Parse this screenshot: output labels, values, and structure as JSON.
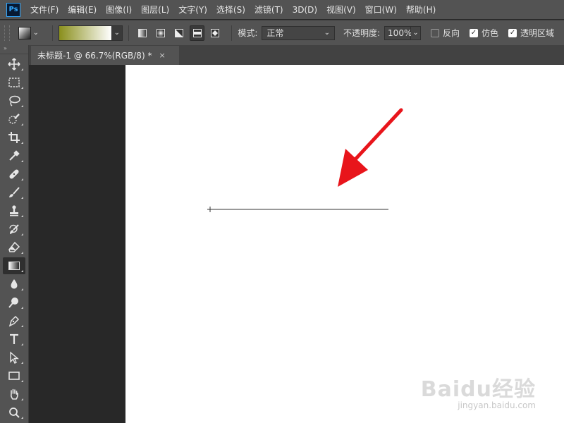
{
  "menubar": {
    "app_logo": "Ps",
    "items": [
      "文件(F)",
      "编辑(E)",
      "图像(I)",
      "图层(L)",
      "文字(Y)",
      "选择(S)",
      "滤镜(T)",
      "3D(D)",
      "视图(V)",
      "窗口(W)",
      "帮助(H)"
    ]
  },
  "options": {
    "gradient_colors": [
      "#8a8f1c",
      "#ffffff"
    ],
    "gradient_types": [
      "linear-gradient-icon",
      "radial-gradient-icon",
      "angle-gradient-icon",
      "reflected-gradient-icon",
      "diamond-gradient-icon"
    ],
    "active_gradient_type": "reflected-gradient-icon",
    "mode_label": "模式:",
    "mode_value": "正常",
    "opacity_label": "不透明度:",
    "opacity_value": "100%",
    "reverse_label": "反向",
    "reverse_checked": false,
    "dither_label": "仿色",
    "dither_checked": true,
    "transparency_label": "透明区域",
    "transparency_checked": true
  },
  "toolbar": {
    "collapse_glyph": "»",
    "tools": [
      "move-tool-icon",
      "marquee-tool-icon",
      "lasso-tool-icon",
      "quick-select-tool-icon",
      "crop-tool-icon",
      "eyedropper-tool-icon",
      "healing-brush-tool-icon",
      "brush-tool-icon",
      "clone-stamp-tool-icon",
      "history-brush-tool-icon",
      "eraser-tool-icon",
      "gradient-tool-icon",
      "blur-tool-icon",
      "dodge-tool-icon",
      "pen-tool-icon",
      "type-tool-icon",
      "path-select-tool-icon",
      "rectangle-tool-icon",
      "hand-tool-icon",
      "zoom-tool-icon"
    ],
    "active_tool": "gradient-tool-icon"
  },
  "document": {
    "tab_title": "未标题-1 @ 66.7%(RGB/8) *",
    "close_glyph": "×",
    "canvas_color": "#ffffff"
  },
  "annotation": {
    "arrow_color": "#e8151b"
  },
  "watermark": {
    "logo": "Baidu经验",
    "url": "jingyan.baidu.com"
  }
}
